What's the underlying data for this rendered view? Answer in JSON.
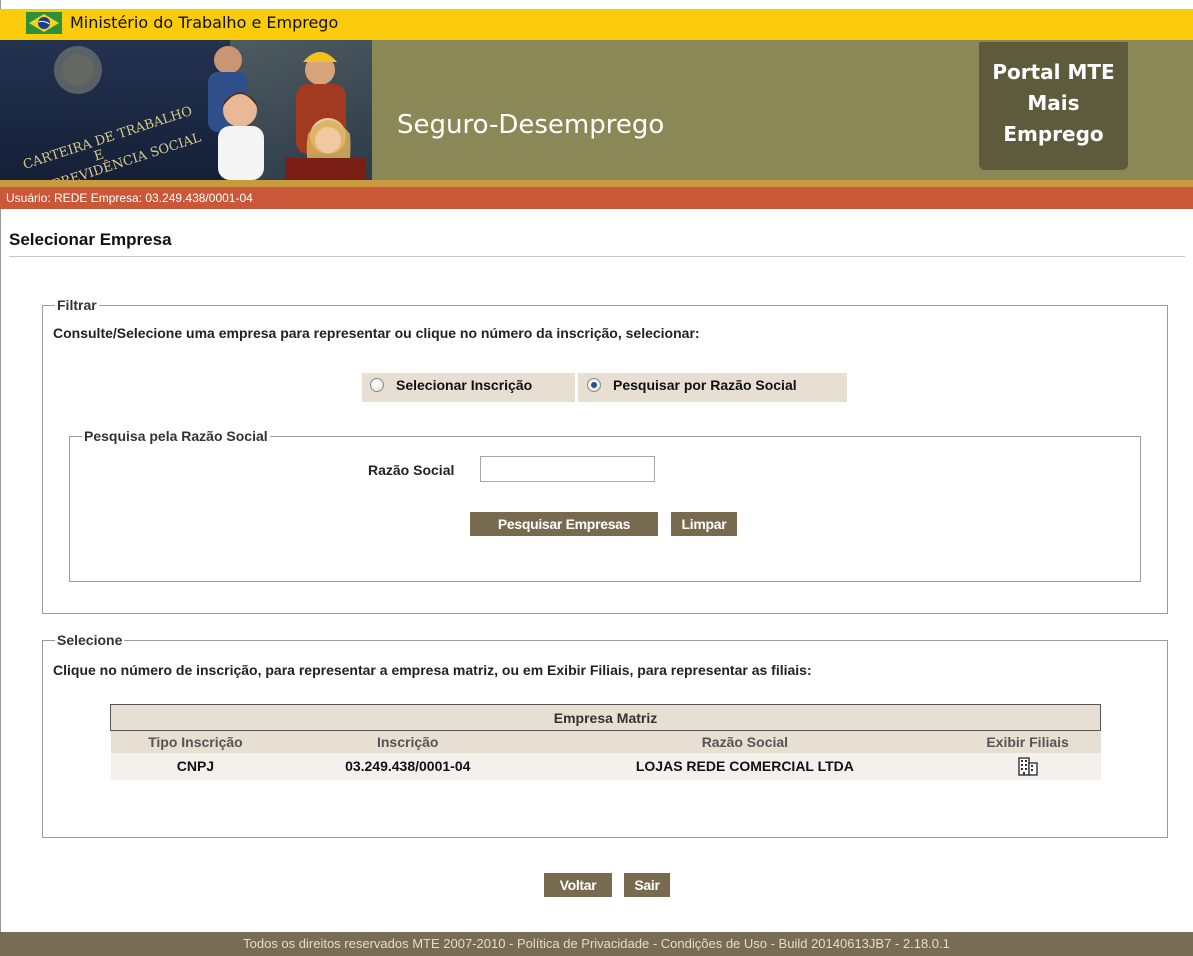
{
  "header": {
    "ministry_title": "Ministério do Trabalho e Emprego",
    "system_title": "Seguro-Desemprego",
    "portal_lines": [
      "Portal MTE",
      "Mais",
      "Emprego"
    ],
    "banner_photo_text": [
      "CARTEIRA DE TRABALHO",
      "E",
      "PREVIDÊNCIA SOCIAL"
    ]
  },
  "user_bar": {
    "text": "Usuário: REDE Empresa: 03.249.438/0001-04"
  },
  "page": {
    "title": "Selecionar Empresa"
  },
  "filter": {
    "legend": "Filtrar",
    "instructions": "Consulte/Selecione uma empresa para representar ou clique no número da inscrição, selecionar:",
    "radio_options": [
      {
        "label": "Selecionar Inscrição",
        "selected": false
      },
      {
        "label": "Pesquisar por Razão Social",
        "selected": true
      }
    ],
    "search": {
      "legend": "Pesquisa pela Razão Social",
      "field_label": "Razão Social",
      "field_value": "",
      "search_button": "Pesquisar Empresas",
      "clear_button": "Limpar"
    }
  },
  "select": {
    "legend": "Selecione",
    "instructions": "Clique no número de inscrição, para representar a empresa matriz, ou em Exibir Filiais, para representar as filiais:",
    "table": {
      "caption": "Empresa Matriz",
      "columns": [
        "Tipo Inscrição",
        "Inscrição",
        "Razão Social",
        "Exibir Filiais"
      ],
      "rows": [
        {
          "tipo": "CNPJ",
          "inscricao": "03.249.438/0001-04",
          "razao_social": "LOJAS REDE COMERCIAL LTDA",
          "filiais_icon": "building-icon"
        }
      ]
    }
  },
  "actions": {
    "back": "Voltar",
    "exit": "Sair"
  },
  "footer": {
    "text": "Todos os direitos reservados MTE 2007-2010 - Política de Privacidade - Condições de Uso - Build 20140613JB7 - 2.18.0.1"
  },
  "colors": {
    "ministry_bar": "#fbcc0b",
    "banner": "#8b8858",
    "portal_box": "#5e5a3c",
    "user_bar": "#ca5737",
    "button": "#776a4e",
    "table_header": "#e7dfd2",
    "link": "#7b6d2a",
    "footer": "#776d55"
  }
}
